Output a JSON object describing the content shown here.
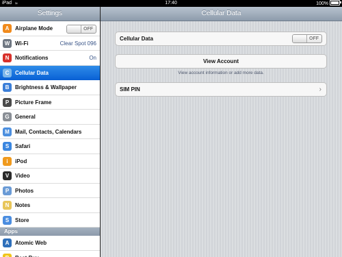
{
  "status_bar": {
    "carrier": "iPad",
    "time": "17:40",
    "battery": "100%"
  },
  "sidebar": {
    "title": "Settings",
    "items": [
      {
        "label": "Airplane Mode",
        "icon": "airplane-icon",
        "color": "#f08a1c",
        "toggle": "OFF"
      },
      {
        "label": "Wi-Fi",
        "icon": "wifi-icon",
        "color": "#6f7782",
        "value": "Clear Spot 096"
      },
      {
        "label": "Notifications",
        "icon": "notifications-icon",
        "color": "#d8312b",
        "value": "On"
      },
      {
        "label": "Cellular Data",
        "icon": "cellular-icon",
        "color": "#7fb8ea",
        "selected": true
      },
      {
        "label": "Brightness & Wallpaper",
        "icon": "brightness-icon",
        "color": "#3b7ed8"
      },
      {
        "label": "Picture Frame",
        "icon": "picture-frame-icon",
        "color": "#4a4a4a"
      },
      {
        "label": "General",
        "icon": "gear-icon",
        "color": "#8a8f96"
      },
      {
        "label": "Mail, Contacts, Calendars",
        "icon": "mail-icon",
        "color": "#4c8fdf"
      },
      {
        "label": "Safari",
        "icon": "safari-icon",
        "color": "#3a86e0"
      },
      {
        "label": "iPod",
        "icon": "ipod-icon",
        "color": "#f09a1d"
      },
      {
        "label": "Video",
        "icon": "video-icon",
        "color": "#2b2b2b"
      },
      {
        "label": "Photos",
        "icon": "photos-icon",
        "color": "#6a9bd6"
      },
      {
        "label": "Notes",
        "icon": "notes-icon",
        "color": "#e8c65a"
      },
      {
        "label": "Store",
        "icon": "store-icon",
        "color": "#4a8de0"
      }
    ],
    "apps_header": "Apps",
    "apps": [
      {
        "label": "Atomic Web",
        "icon": "atomic-web-icon",
        "color": "#2e6fba"
      },
      {
        "label": "Best Buy",
        "icon": "best-buy-icon",
        "color": "#f0c419"
      }
    ]
  },
  "detail": {
    "title": "Cellular Data",
    "cellular_label": "Cellular Data",
    "cellular_toggle": "OFF",
    "view_account_label": "View Account",
    "view_account_desc": "View account information or add more data.",
    "sim_pin_label": "SIM PIN"
  }
}
